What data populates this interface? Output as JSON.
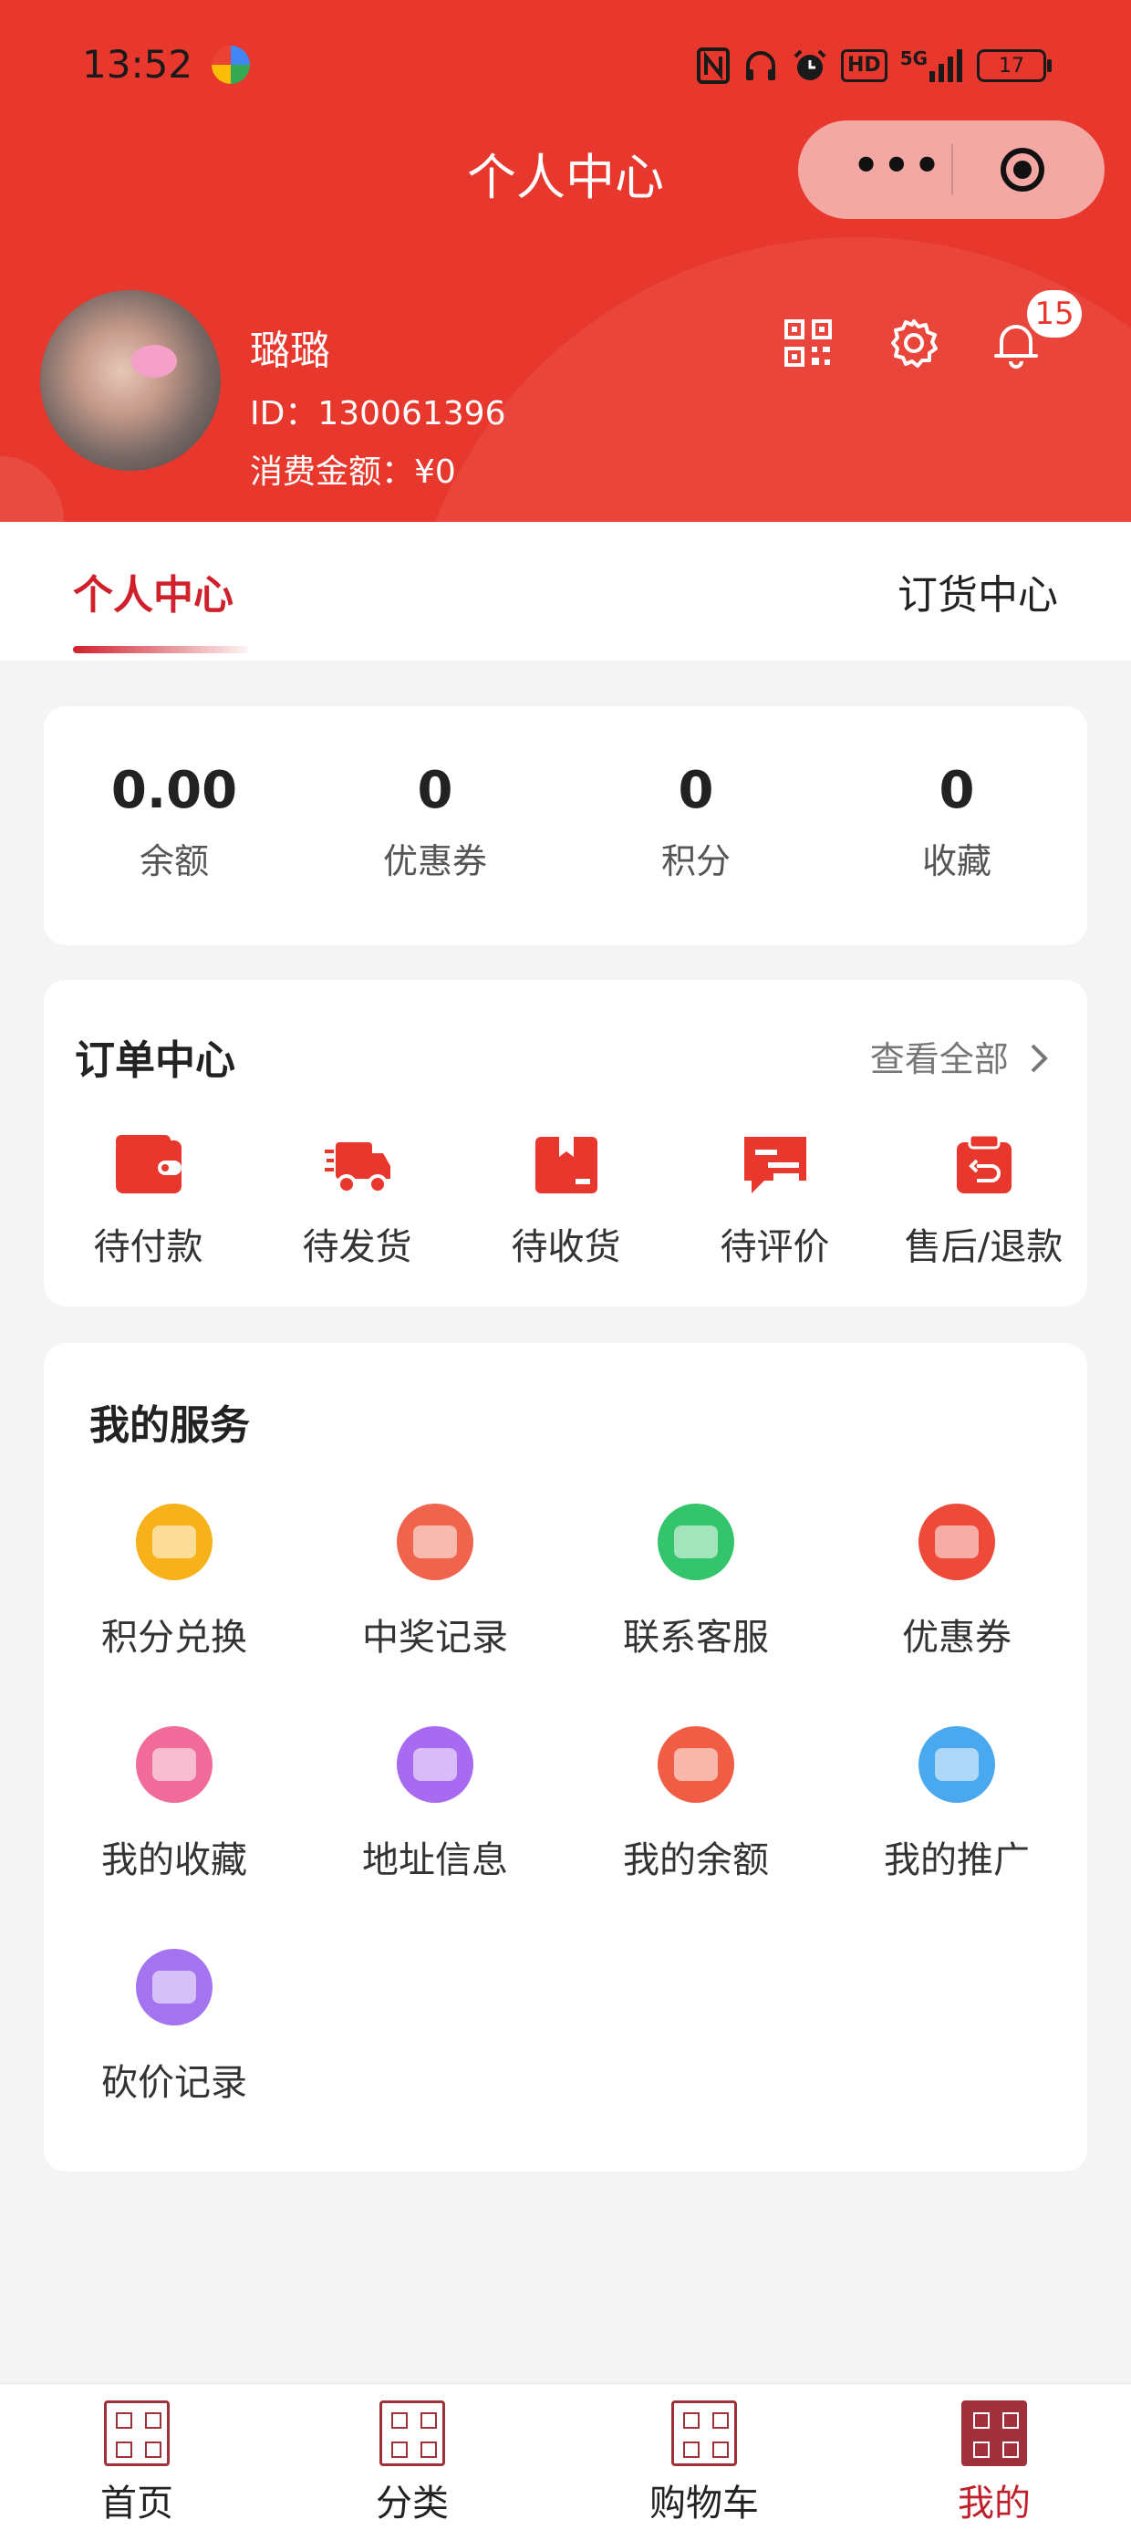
{
  "status_bar": {
    "time": "13:52",
    "network": "5G",
    "hd_label": "HD",
    "battery": "17"
  },
  "nav": {
    "title": "个人中心",
    "more_label": "•••"
  },
  "profile": {
    "name": "璐璐",
    "id_label": "ID：",
    "id_value": "130061396",
    "spend_label": "消费金额：",
    "spend_value": "¥0",
    "notification_count": "15"
  },
  "tabs": {
    "left": "个人中心",
    "right": "订货中心"
  },
  "stats": [
    {
      "value": "0.00",
      "label": "余额"
    },
    {
      "value": "0",
      "label": "优惠券"
    },
    {
      "value": "0",
      "label": "积分"
    },
    {
      "value": "0",
      "label": "收藏"
    }
  ],
  "orders": {
    "title": "订单中心",
    "see_all": "查看全部",
    "items": [
      {
        "label": "待付款",
        "icon": "wallet-icon"
      },
      {
        "label": "待发货",
        "icon": "delivery-truck-icon"
      },
      {
        "label": "待收货",
        "icon": "package-icon"
      },
      {
        "label": "待评价",
        "icon": "review-icon"
      },
      {
        "label": "售后/退款",
        "icon": "refund-icon"
      }
    ]
  },
  "services": {
    "title": "我的服务",
    "items": [
      {
        "label": "积分兑换",
        "icon": "points-exchange-icon",
        "color": "#f7b21b"
      },
      {
        "label": "中奖记录",
        "icon": "lottery-wheel-icon",
        "color": "#f0644e"
      },
      {
        "label": "联系客服",
        "icon": "customer-service-icon",
        "color": "#34c46b"
      },
      {
        "label": "优惠券",
        "icon": "coupon-icon",
        "color": "#ee4a3a"
      },
      {
        "label": "我的收藏",
        "icon": "favorites-icon",
        "color": "#f06a9a"
      },
      {
        "label": "地址信息",
        "icon": "address-pin-icon",
        "color": "#a86af0"
      },
      {
        "label": "我的余额",
        "icon": "money-bag-icon",
        "color": "#f15d44"
      },
      {
        "label": "我的推广",
        "icon": "promotion-icon",
        "color": "#4aa9ee"
      },
      {
        "label": "砍价记录",
        "icon": "bargain-icon",
        "color": "#a373f0"
      }
    ]
  },
  "bottom_nav": [
    {
      "label": "首页",
      "icon": "home-seal-icon",
      "active": false
    },
    {
      "label": "分类",
      "icon": "category-seal-icon",
      "active": false
    },
    {
      "label": "购物车",
      "icon": "cart-seal-icon",
      "active": false
    },
    {
      "label": "我的",
      "icon": "profile-seal-icon",
      "active": true
    }
  ],
  "colors": {
    "brand_red": "#e8372c",
    "active_tab": "#d0202c",
    "seal": "#a0303a"
  }
}
